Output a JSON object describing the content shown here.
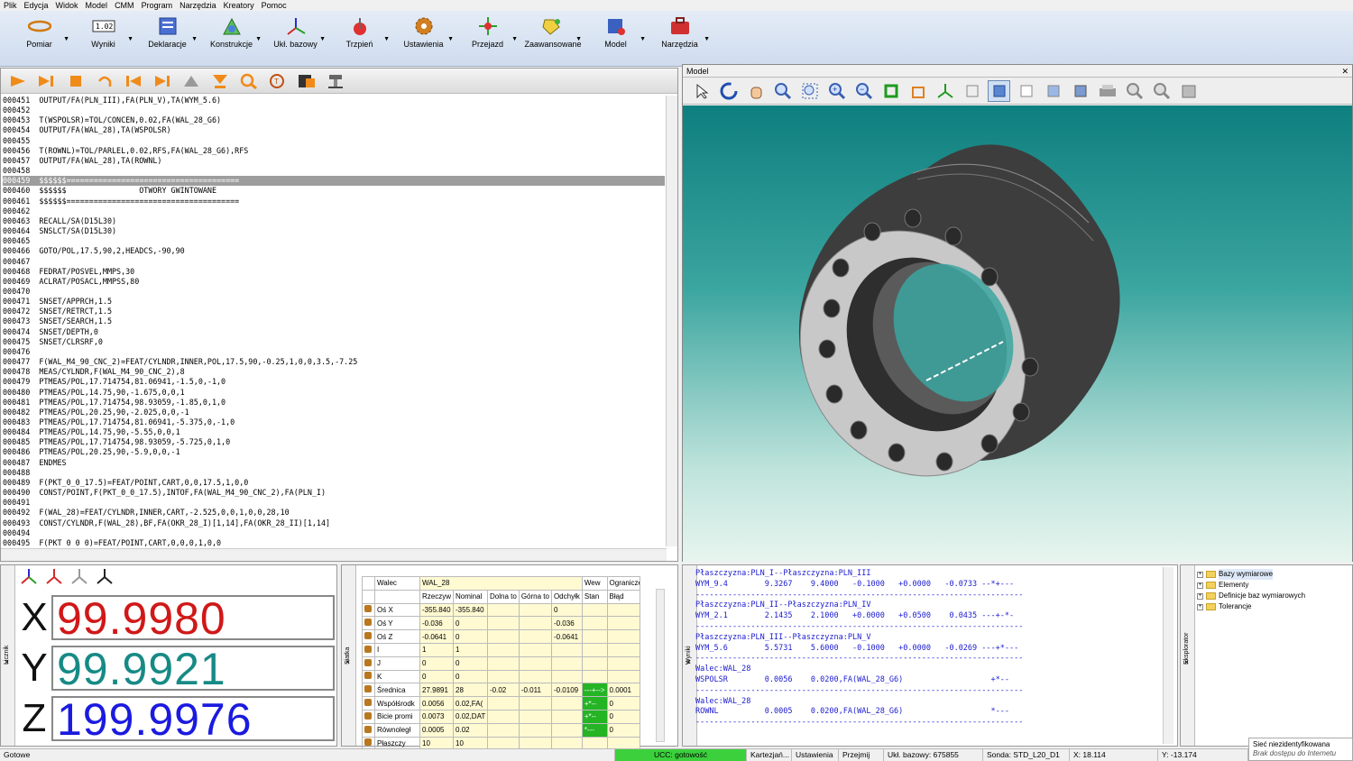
{
  "menu": [
    "Plik",
    "Edycja",
    "Widok",
    "Model",
    "CMM",
    "Program",
    "Narzędzia",
    "Kreatory",
    "Pomoc"
  ],
  "ribbon": [
    {
      "label": "Pomiar",
      "icon": "measure-icon"
    },
    {
      "label": "Wyniki",
      "icon": "results-icon"
    },
    {
      "label": "Deklaracje",
      "icon": "declarations-icon"
    },
    {
      "label": "Konstrukcje",
      "icon": "construction-icon"
    },
    {
      "label": "Ukł. bazowy",
      "icon": "coordinate-system-icon"
    },
    {
      "label": "Trzpień",
      "icon": "stylus-icon"
    },
    {
      "label": "Ustawienia",
      "icon": "settings-icon"
    },
    {
      "label": "Przejazd",
      "icon": "move-icon"
    },
    {
      "label": "Zaawansowane",
      "icon": "advanced-icon"
    },
    {
      "label": "Model",
      "icon": "model-icon"
    },
    {
      "label": "Narzędzia",
      "icon": "tools-icon"
    }
  ],
  "code_lines": [
    "000451  OUTPUT/FA(PLN_III),FA(PLN_V),TA(WYM_5.6)",
    "000452",
    "000453  T(WSPOLSR)=TOL/CONCEN,0.02,FA(WAL_28_G6)",
    "000454  OUTPUT/FA(WAL_28),TA(WSPOLSR)",
    "000455",
    "000456  T(ROWNL)=TOL/PARLEL,0.02,RFS,FA(WAL_28_G6),RFS",
    "000457  OUTPUT/FA(WAL_28),TA(ROWNL)",
    "000458",
    "000459  $$$$$$======================================",
    "000460  $$$$$$                OTWORY GWINTOWANE",
    "000461  $$$$$$======================================",
    "000462",
    "000463  RECALL/SA(D15L30)",
    "000464  SNSLCT/SA(D15L30)",
    "000465",
    "000466  GOTO/POL,17.5,90,2,HEADCS,-90,90",
    "000467",
    "000468  FEDRAT/POSVEL,MMPS,30",
    "000469  ACLRAT/POSACL,MMPSS,80",
    "000470",
    "000471  SNSET/APPRCH,1.5",
    "000472  SNSET/RETRCT,1.5",
    "000473  SNSET/SEARCH,1.5",
    "000474  SNSET/DEPTH,0",
    "000475  SNSET/CLRSRF,0",
    "000476",
    "000477  F(WAL_M4_90_CNC_2)=FEAT/CYLNDR,INNER,POL,17.5,90,-0.25,1,0,0,3.5,-7.25",
    "000478  MEAS/CYLNDR,F(WAL_M4_90_CNC_2),8",
    "000479  PTMEAS/POL,17.714754,81.06941,-1.5,0,-1,0",
    "000480  PTMEAS/POL,14.75,90,-1.675,0,0,1",
    "000481  PTMEAS/POL,17.714754,98.93059,-1.85,0,1,0",
    "000482  PTMEAS/POL,20.25,90,-2.025,0,0,-1",
    "000483  PTMEAS/POL,17.714754,81.06941,-5.375,0,-1,0",
    "000484  PTMEAS/POL,14.75,90,-5.55,0,0,1",
    "000485  PTMEAS/POL,17.714754,98.93059,-5.725,0,1,0",
    "000486  PTMEAS/POL,20.25,90,-5.9,0,0,-1",
    "000487  ENDMES",
    "000488",
    "000489  F(PKT_0_0_17.5)=FEAT/POINT,CART,0,0,17.5,1,0,0",
    "000490  CONST/POINT,F(PKT_0_0_17.5),INTOF,FA(WAL_M4_90_CNC_2),FA(PLN_I)",
    "000491",
    "000492  F(WAL_28)=FEAT/CYLNDR,INNER,CART,-2.525,0,0,1,0,0,28,10",
    "000493  CONST/CYLNDR,F(WAL_28),BF,FA(OKR_28_I)[1,14],FA(OKR_28_II)[1,14]",
    "000494",
    "000495  F(PKT_0_0_0)=FEAT/POINT,CART,0,0,0,1,0,0"
  ],
  "model_panel": {
    "title": "Model"
  },
  "coords": {
    "x_label": "X",
    "x_value": "99.9980",
    "x_color": "#d01818",
    "y_label": "Y",
    "y_value": "99.9921",
    "y_color": "#178a85",
    "z_label": "Z",
    "z_value": "199.9976",
    "z_color": "#1a1ae0",
    "side_tab": "Licznik"
  },
  "grid": {
    "side_tab": "Siatka",
    "header_type": "Walec",
    "header_name": "WAL_28",
    "header_wew": "Wew",
    "header_ogr": "Ograniczenie",
    "columns": [
      "Rzeczyw",
      "Nominal",
      "Dolna to",
      "Górna to",
      "Odchyłk",
      "Stan",
      "Błąd"
    ],
    "rows": [
      {
        "name": "Oś X",
        "vals": [
          "-355.840",
          "-355.840",
          "",
          "",
          "0",
          "",
          ""
        ]
      },
      {
        "name": "Oś Y",
        "vals": [
          "-0.036",
          "0",
          "",
          "",
          "-0.036",
          "",
          ""
        ]
      },
      {
        "name": "Oś Z",
        "vals": [
          "-0.0641",
          "0",
          "",
          "",
          "-0.0641",
          "",
          ""
        ]
      },
      {
        "name": "I",
        "vals": [
          "1",
          "1",
          "",
          "",
          "",
          "",
          ""
        ]
      },
      {
        "name": "J",
        "vals": [
          "0",
          "0",
          "",
          "",
          "",
          "",
          ""
        ]
      },
      {
        "name": "K",
        "vals": [
          "0",
          "0",
          "",
          "",
          "",
          "",
          ""
        ]
      },
      {
        "name": "Średnica",
        "vals": [
          "27.9891",
          "28",
          "-0.02",
          "-0.011",
          "-0.0109",
          "---+-->",
          "0.0001"
        ]
      },
      {
        "name": "Współśrodk",
        "vals": [
          "0.0056",
          "0.02,FA(",
          "",
          "",
          "",
          "+*--",
          "0"
        ]
      },
      {
        "name": "Bicie promi",
        "vals": [
          "0.0073",
          "0.02,DAT",
          "",
          "",
          "",
          "+*--",
          "0"
        ]
      },
      {
        "name": "Równoległ",
        "vals": [
          "0.0005",
          "0.02",
          "",
          "",
          "",
          "*---",
          "0"
        ]
      },
      {
        "name": "Płaszczy",
        "vals": [
          "10",
          "10",
          "",
          "",
          "",
          "",
          ""
        ]
      }
    ]
  },
  "results": {
    "side_tab": "Wyniki",
    "lines": [
      "Płaszczyzna:PLN_I--Płaszczyzna:PLN_III",
      "WYM_9.4        9.3267    9.4000   -0.1000   +0.0000   -0.0733 --*+---",
      "-----------------------------------------------------------------------",
      "Płaszczyzna:PLN_II--Płaszczyzna:PLN_IV",
      "WYM_2.1        2.1435    2.1000   +0.0000   +0.0500    0.0435 ---+-*-",
      "-----------------------------------------------------------------------",
      "Płaszczyzna:PLN_III--Płaszczyzna:PLN_V",
      "WYM_5.6        5.5731    5.6000   -0.1000   +0.0000   -0.0269 ---+*---",
      "-----------------------------------------------------------------------",
      "Walec:WAL_28",
      "WSPOLSR        0.0056    0.0200,FA(WAL_28_G6)                   +*--",
      "-----------------------------------------------------------------------",
      "Walec:WAL_28",
      "ROWNL          0.0005    0.0200,FA(WAL_28_G6)                   *---",
      "-----------------------------------------------------------------------"
    ]
  },
  "tree": {
    "side_tab": "Eksplorator",
    "items": [
      "Bazy wymiarowe",
      "Elementy",
      "Definicje baz wymiarowych",
      "Tolerancje"
    ]
  },
  "status": {
    "ready": "Gotowe",
    "ucc": "UCC: gotowość",
    "cart": "Kartezjań...",
    "settings": "Ustawienia",
    "przejmij": "Przejmij",
    "base": "Ukł. bazowy: 675855",
    "probe": "Sonda: STD_L20_D1",
    "x": "X: 18.114",
    "y": "Y: -13.174"
  },
  "notification": {
    "line1": "Sieć niezidentyfikowana",
    "line2": "Brak dostępu do Internetu"
  }
}
